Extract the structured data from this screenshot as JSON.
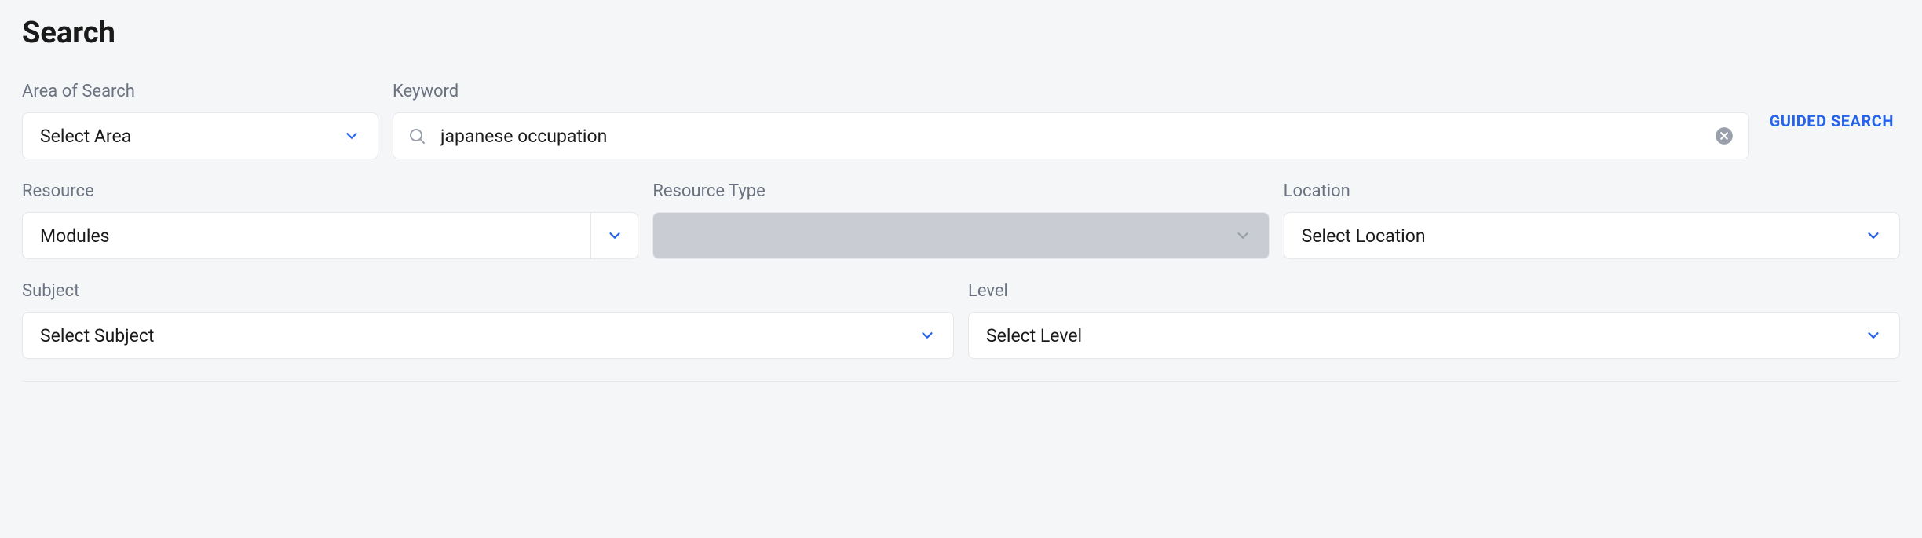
{
  "title": "Search",
  "area": {
    "label": "Area of Search",
    "value": "Select Area"
  },
  "keyword": {
    "label": "Keyword",
    "value": "japanese occupation"
  },
  "guided_search": "GUIDED SEARCH",
  "resource": {
    "label": "Resource",
    "value": "Modules"
  },
  "resource_type": {
    "label": "Resource Type",
    "value": ""
  },
  "location": {
    "label": "Location",
    "value": "Select Location"
  },
  "subject": {
    "label": "Subject",
    "value": "Select Subject"
  },
  "level": {
    "label": "Level",
    "value": "Select Level"
  }
}
